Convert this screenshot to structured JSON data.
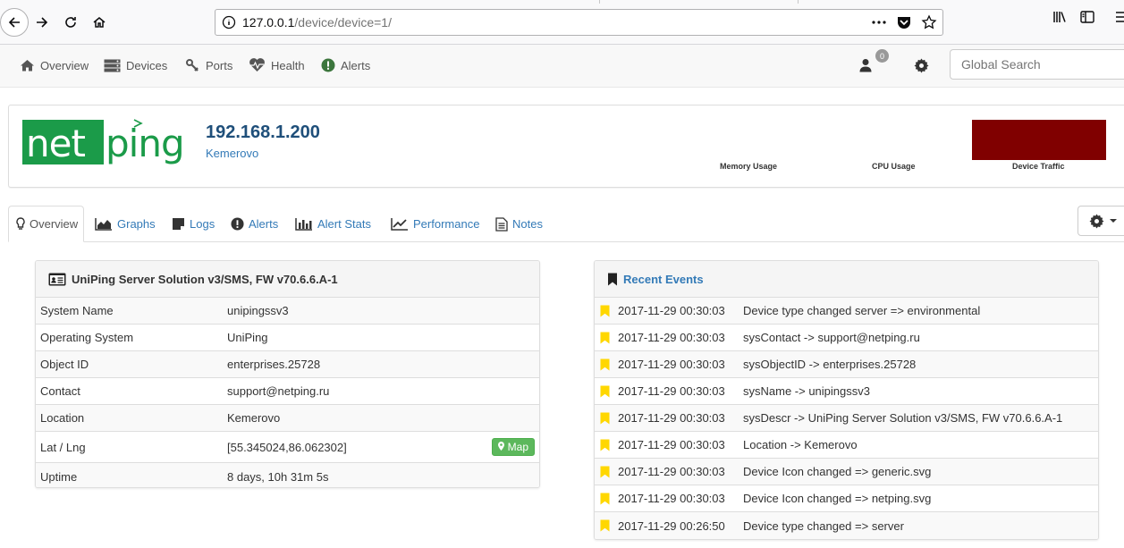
{
  "browser": {
    "url_host": "127.0.0.1",
    "url_path": "/device/device=1/"
  },
  "nav": {
    "items": [
      {
        "label": "Overview",
        "icon": "home-icon"
      },
      {
        "label": "Devices",
        "icon": "server-icon"
      },
      {
        "label": "Ports",
        "icon": "plug-icon"
      },
      {
        "label": "Health",
        "icon": "heartbeat-icon"
      },
      {
        "label": "Alerts",
        "icon": "exclamation-circle-icon"
      }
    ],
    "user_badge": "0",
    "search_placeholder": "Global Search"
  },
  "device": {
    "ip": "192.168.1.200",
    "location": "Kemerovo",
    "logo_text": "netping",
    "memory_label": "Memory Usage",
    "cpu_label": "CPU Usage",
    "traffic_label": "Device Traffic",
    "traffic_color": "#800000"
  },
  "tabs": [
    {
      "label": "Overview",
      "icon": "lightbulb-icon"
    },
    {
      "label": "Graphs",
      "icon": "area-chart-icon"
    },
    {
      "label": "Logs",
      "icon": "sticky-note-icon"
    },
    {
      "label": "Alerts",
      "icon": "exclamation-circle-icon"
    },
    {
      "label": "Alert Stats",
      "icon": "bar-chart-icon"
    },
    {
      "label": "Performance",
      "icon": "line-chart-icon"
    },
    {
      "label": "Notes",
      "icon": "file-text-icon"
    }
  ],
  "overview": {
    "title": "UniPing Server Solution v3/SMS, FW v70.6.6.A-1",
    "rows": [
      {
        "key": "System Name",
        "value": "unipingssv3"
      },
      {
        "key": "Operating System",
        "value": "UniPing"
      },
      {
        "key": "Object ID",
        "value": "enterprises.25728"
      },
      {
        "key": "Contact",
        "value": "support@netping.ru"
      },
      {
        "key": "Location",
        "value": "Kemerovo"
      },
      {
        "key": "Lat / Lng",
        "value": "[55.345024,86.062302]"
      },
      {
        "key": "Uptime",
        "value": "8 days, 10h 31m 5s"
      }
    ],
    "map_label": "Map"
  },
  "events": {
    "title": "Recent Events",
    "rows": [
      {
        "time": "2017-11-29 00:30:03",
        "message": "Device type changed server => environmental"
      },
      {
        "time": "2017-11-29 00:30:03",
        "message": "sysContact -> support@netping.ru"
      },
      {
        "time": "2017-11-29 00:30:03",
        "message": "sysObjectID -> enterprises.25728"
      },
      {
        "time": "2017-11-29 00:30:03",
        "message": "sysName -> unipingssv3"
      },
      {
        "time": "2017-11-29 00:30:03",
        "message": "sysDescr -> UniPing Server Solution v3/SMS, FW v70.6.6.A-1"
      },
      {
        "time": "2017-11-29 00:30:03",
        "message": "Location -> Kemerovo"
      },
      {
        "time": "2017-11-29 00:30:03",
        "message": "Device Icon changed => generic.svg"
      },
      {
        "time": "2017-11-29 00:30:03",
        "message": "Device Icon changed => netping.svg"
      },
      {
        "time": "2017-11-29 00:26:50",
        "message": "Device type changed => server"
      }
    ]
  }
}
